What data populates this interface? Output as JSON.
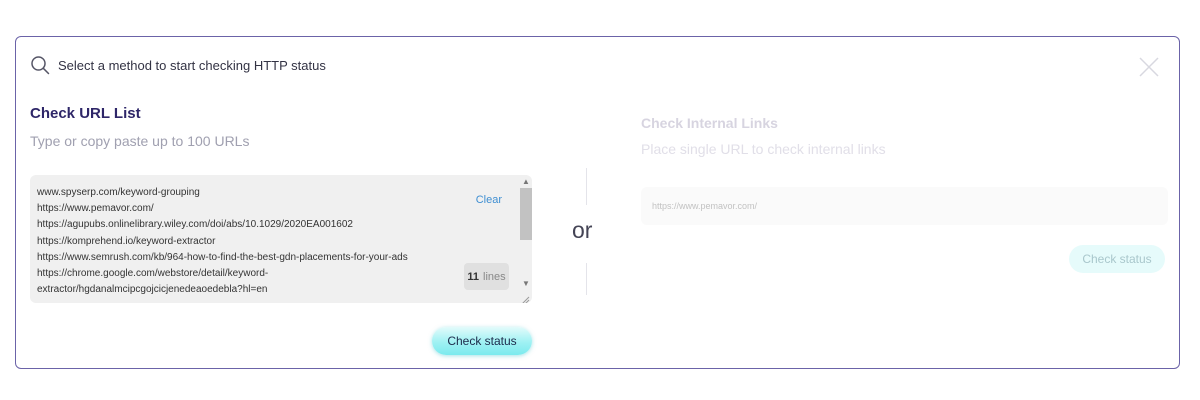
{
  "search": {
    "title": "Select a method to start checking HTTP status"
  },
  "url_list": {
    "heading": "Check URL List",
    "subtext": "Type or copy paste up to 100 URLs",
    "lines": [
      "www.spyserp.com/keyword-grouping",
      "https://www.pemavor.com/",
      "https://agupubs.onlinelibrary.wiley.com/doi/abs/10.1029/2020EA001602",
      "https://komprehend.io/keyword-extractor",
      "https://www.semrush.com/kb/964-how-to-find-the-best-gdn-placements-for-your-ads",
      "https://chrome.google.com/webstore/detail/keyword-",
      "extractor/hgdanalmcipcgojcicjenedeaoedebla?hl=en"
    ],
    "clear_label": "Clear",
    "line_count": "11",
    "line_unit": "lines",
    "button_label": "Check status"
  },
  "separator": {
    "label": "or"
  },
  "internal_links": {
    "heading": "Check Internal Links",
    "subtext": "Place single URL to check internal links",
    "placeholder": "https://www.pemavor.com/",
    "button_label": "Check status"
  },
  "colors": {
    "border": "#6b63a8",
    "heading": "#2e2668",
    "accent": "#7beaee",
    "link": "#3f8fd2"
  },
  "icons": {
    "search": "search-icon",
    "close": "close-icon"
  }
}
